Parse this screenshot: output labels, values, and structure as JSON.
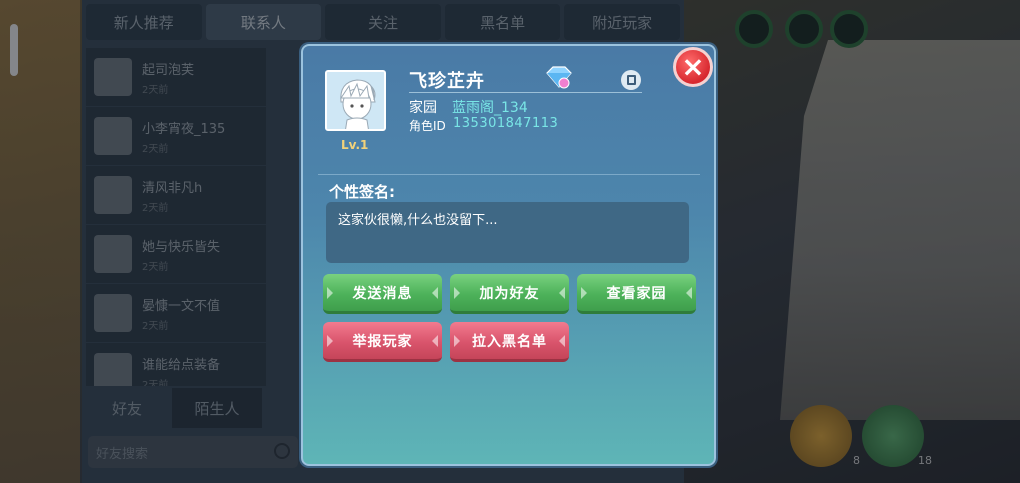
{
  "social": {
    "tabs": [
      "新人推荐",
      "联系人",
      "关注",
      "黑名单",
      "附近玩家"
    ],
    "contacts": [
      {
        "name": "起司泡芙",
        "sub": "2天前"
      },
      {
        "name": "小李宵夜_135",
        "sub": "2天前"
      },
      {
        "name": "清风非凡h",
        "sub": "2天前"
      },
      {
        "name": "她与快乐皆失",
        "sub": "2天前"
      },
      {
        "name": "晏慷一文不值",
        "sub": "2天前"
      },
      {
        "name": "谁能给点装备",
        "sub": "2天前"
      }
    ],
    "friend_tabs": [
      "好友",
      "陌生人"
    ],
    "search_placeholder": "好友搜索"
  },
  "hud": {
    "mic_counts": [
      "8",
      "18"
    ]
  },
  "profile": {
    "nickname": "飞珍芷卉",
    "level": "Lv.1",
    "home_label": "家园",
    "home_value": "蓝雨阁_134",
    "role_id_label": "角色ID",
    "role_id_value": "135301847113",
    "signature_title": "个性签名:",
    "signature_text": "这家伙很懒,什么也没留下...",
    "buttons": {
      "send_message": "发送消息",
      "add_friend": "加为好友",
      "view_home": "查看家园",
      "report_player": "举报玩家",
      "blacklist": "拉入黑名单"
    },
    "icons": [
      "close-icon",
      "gem-badge-icon",
      "copy-icon"
    ],
    "colors": {
      "accent_cyan": "#79e6e6",
      "green_button": "#4db25a",
      "red_button": "#d9546c",
      "close_red": "#d7282f"
    }
  }
}
